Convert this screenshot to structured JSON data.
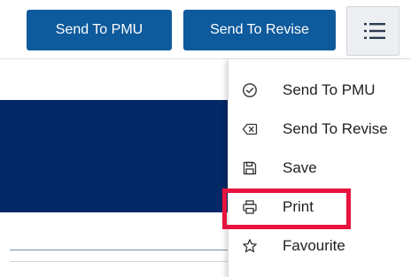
{
  "toolbar": {
    "send_to_pmu_label": "Send To PMU",
    "send_to_revise_label": "Send To Revise",
    "menu_icon": "hamburger-menu-icon"
  },
  "menu": {
    "items": [
      {
        "label": "Send To PMU",
        "icon": "check-circle-icon"
      },
      {
        "label": "Send To Revise",
        "icon": "backspace-icon"
      },
      {
        "label": "Save",
        "icon": "floppy-disk-icon"
      },
      {
        "label": "Print",
        "icon": "printer-icon"
      },
      {
        "label": "Favourite",
        "icon": "star-icon"
      }
    ],
    "highlighted_item": "Print"
  },
  "colors": {
    "primary_button": "#0d5a9c",
    "hero_band": "#032868",
    "highlight": "#e8133d",
    "menu_button_bg": "#eceef1"
  }
}
